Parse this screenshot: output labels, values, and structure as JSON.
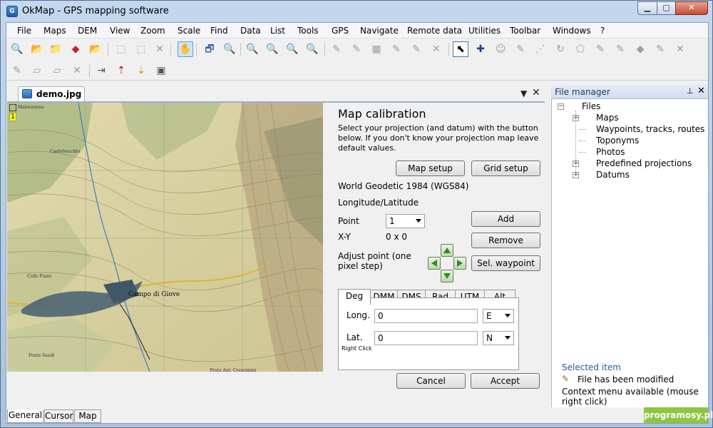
{
  "window": {
    "title": "OkMap - GPS mapping software"
  },
  "menu": [
    "File",
    "Maps",
    "DEM",
    "View",
    "Zoom",
    "Scale",
    "Find",
    "Data",
    "List",
    "Tools",
    "GPS",
    "Navigate",
    "Remote data",
    "Utilities",
    "Toolbar",
    "Windows",
    "?"
  ],
  "document": {
    "tab_label": "demo.jpg",
    "marker_label": "1"
  },
  "calibration": {
    "title": "Map calibration",
    "description": "Select your projection (and datum) with the button below. If you don't know your projection map leave default values.",
    "map_setup_label": "Map setup",
    "grid_setup_label": "Grid setup",
    "datum": "World Geodetic 1984 (WGS84)",
    "projection": "Longitude/Latitude",
    "point_label": "Point",
    "point_value": "1",
    "xy_label": "X-Y",
    "xy_value": "0 x 0",
    "adjust_label": "Adjust point (one pixel step)",
    "add_label": "Add",
    "remove_label": "Remove",
    "sel_waypoint_label": "Sel. waypoint",
    "coord_tabs": [
      "Deg",
      "DMM",
      "DMS",
      "Rad",
      "UTM",
      "Alt"
    ],
    "long_label": "Long.",
    "long_value": "0",
    "long_dir": "E",
    "lat_label": "Lat.",
    "lat_value": "0",
    "lat_dir": "N",
    "right_click_label": "Right Click",
    "cancel_label": "Cancel",
    "accept_label": "Accept"
  },
  "file_manager": {
    "title": "File manager",
    "root": "Files",
    "items": [
      "Maps",
      "Waypoints, tracks, routes",
      "Toponyms",
      "Photos",
      "Predefined projections",
      "Datums"
    ],
    "selected_item_label": "Selected item",
    "modified_text": "File has been modified",
    "context_menu_text": "Context menu available (mouse right click)"
  },
  "bottom_tabs": [
    "General",
    "Cursor",
    "Map"
  ],
  "watermark": "programosy.pl"
}
